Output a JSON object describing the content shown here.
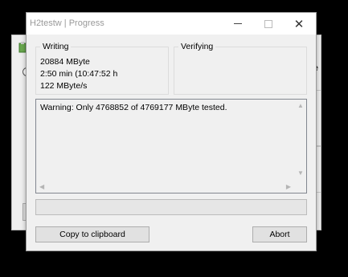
{
  "window": {
    "title": "H2testw | Progress"
  },
  "writing": {
    "label": "Writing",
    "amount": "20884 MByte",
    "time": "2:50 min (10:47:52 h",
    "speed": "122 MByte/s"
  },
  "verifying": {
    "label": "Verifying"
  },
  "log": {
    "message": "Warning: Only 4768852 of 4769177 MByte tested."
  },
  "progress": {
    "fraction": 0
  },
  "buttons": {
    "copy": "Copy to clipboard",
    "abort": "Abort"
  },
  "background_window": {
    "edge_letter": "e"
  },
  "colors": {
    "progress_fill": "#06b025",
    "title_text": "#999999"
  }
}
